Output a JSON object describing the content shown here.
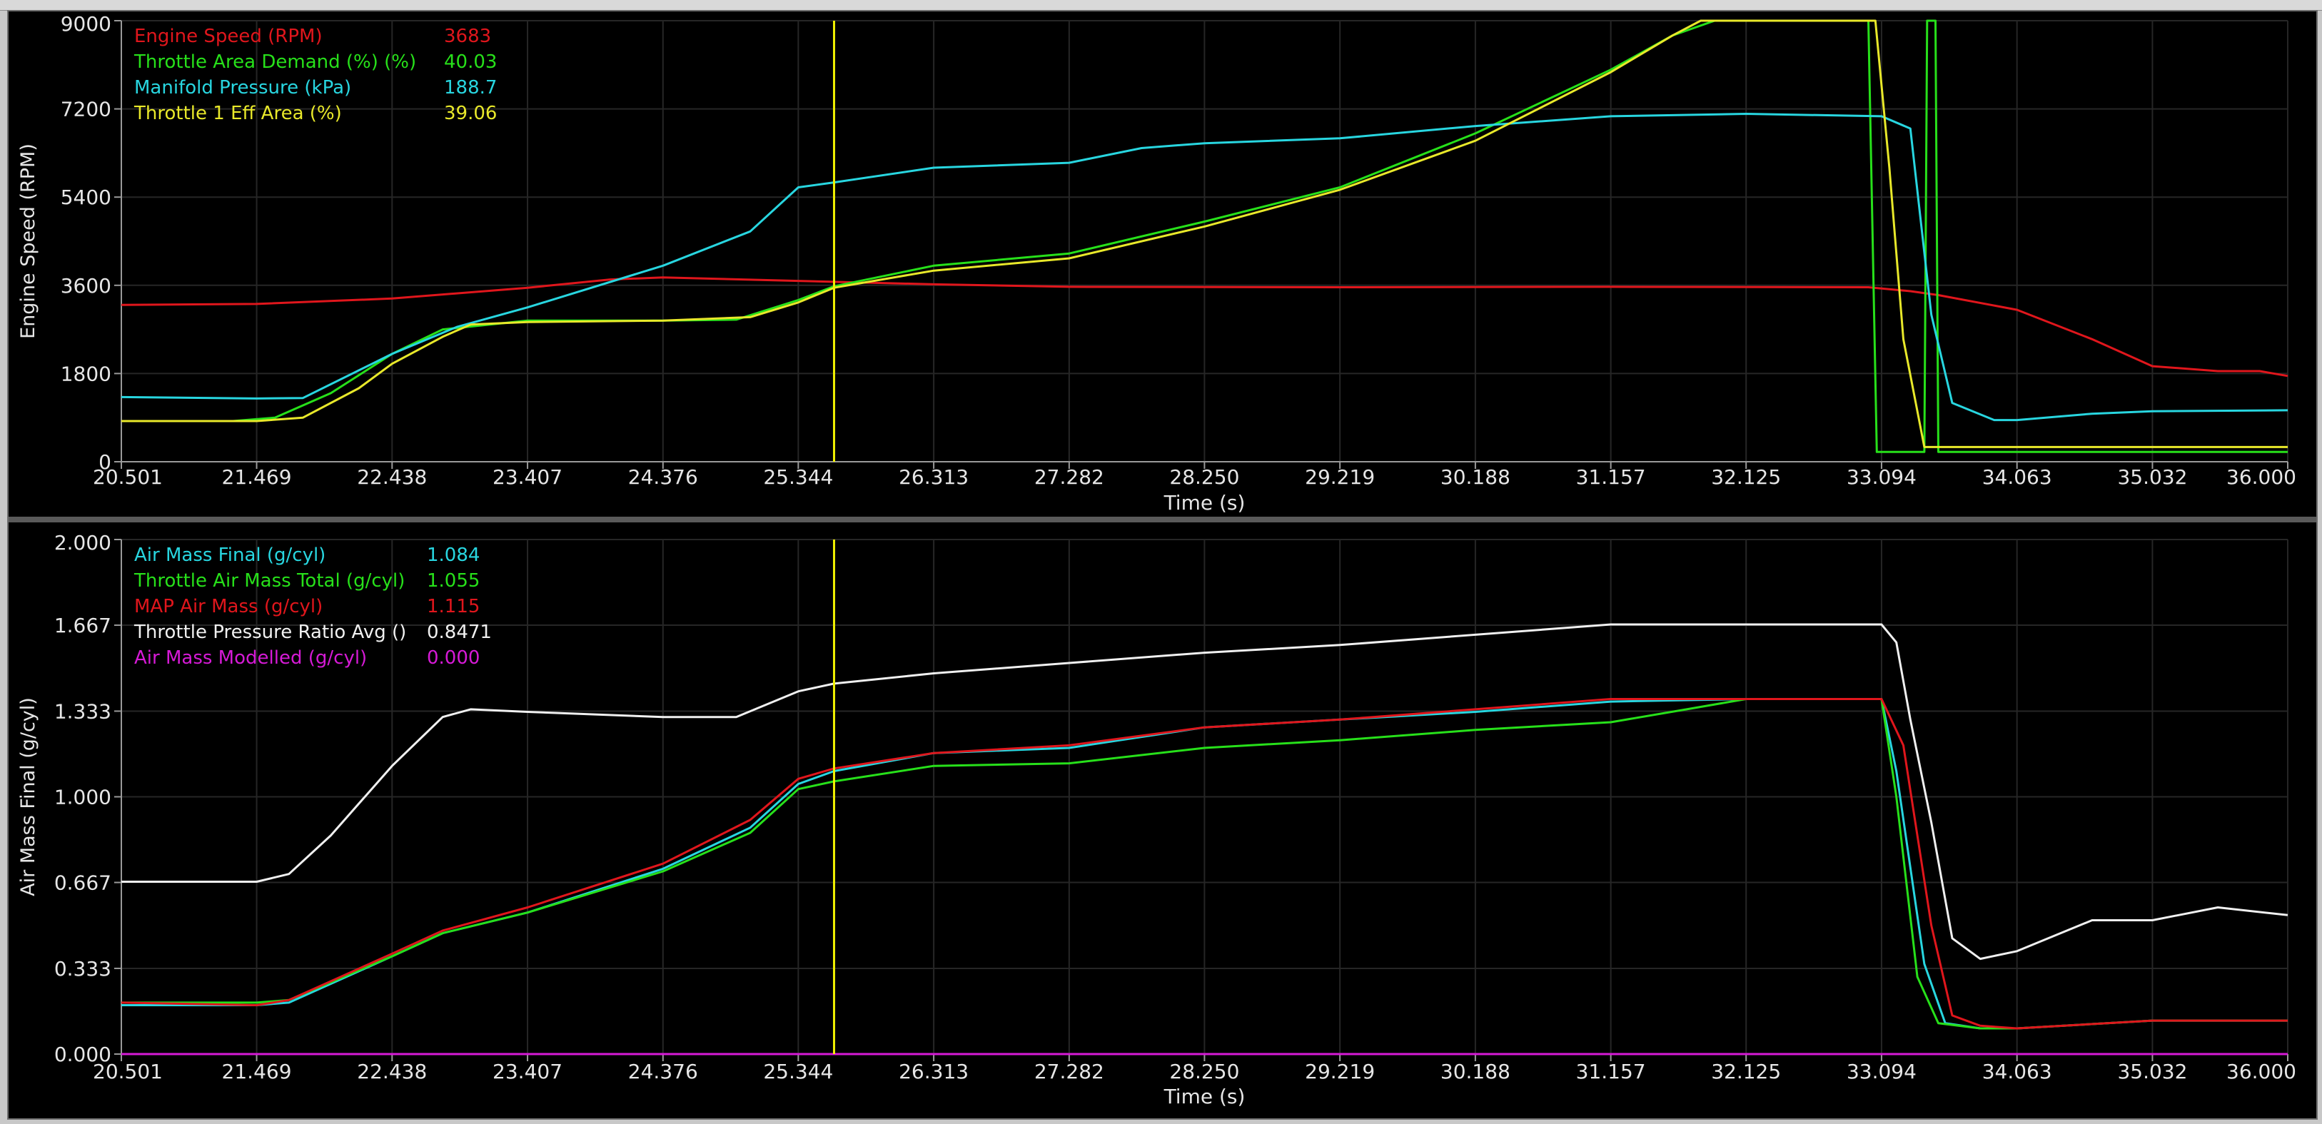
{
  "top": {
    "ylabel": "Engine Speed (RPM)",
    "xlabel": "Time (s)",
    "legend": [
      {
        "label": "Engine Speed (RPM)",
        "value": "3683",
        "color": "#e0161c"
      },
      {
        "label": "Throttle Area Demand  (%) (%)",
        "value": "40.03",
        "color": "#27e01a"
      },
      {
        "label": "Manifold Pressure (kPa)",
        "value": "188.7",
        "color": "#28d6e0"
      },
      {
        "label": "Throttle 1 Eff Area (%)",
        "value": "39.06",
        "color": "#e8e82a"
      }
    ]
  },
  "bottom": {
    "ylabel": "Air Mass Final (g/cyl)",
    "xlabel": "Time (s)",
    "legend": [
      {
        "label": "Air Mass Final (g/cyl)",
        "value": "1.084",
        "color": "#28d6e0"
      },
      {
        "label": "Throttle Air Mass Total (g/cyl)",
        "value": "1.055",
        "color": "#27e01a"
      },
      {
        "label": "MAP Air Mass (g/cyl)",
        "value": "1.115",
        "color": "#e0161c"
      },
      {
        "label": "Throttle Pressure Ratio Avg ()",
        "value": "0.8471",
        "color": "#f0f0f0"
      },
      {
        "label": "Air Mass Modelled  (g/cyl)",
        "value": "0.000",
        "color": "#d61ad6"
      }
    ]
  },
  "chart_data": [
    {
      "type": "line",
      "ylabel": "Engine Speed (RPM)",
      "xlabel": "Time (s)",
      "xlim": [
        20.501,
        36.0
      ],
      "ylim": [
        0,
        9000
      ],
      "xticks": [
        "20.501",
        "21.469",
        "22.438",
        "23.407",
        "24.376",
        "25.344",
        "26.313",
        "27.282",
        "28.250",
        "29.219",
        "30.188",
        "31.157",
        "32.125",
        "33.094",
        "34.063",
        "35.032",
        "36.000"
      ],
      "yticks": [
        "0",
        "1800",
        "3600",
        "5400",
        "7200",
        "9000"
      ],
      "cursor_x": 25.6,
      "series": [
        {
          "name": "Engine Speed (RPM)",
          "color": "#e0161c",
          "points": [
            [
              20.501,
              3200
            ],
            [
              21.469,
              3220
            ],
            [
              22.438,
              3330
            ],
            [
              23.407,
              3550
            ],
            [
              24.0,
              3720
            ],
            [
              24.376,
              3760
            ],
            [
              25.344,
              3690
            ],
            [
              26.313,
              3620
            ],
            [
              27.282,
              3570
            ],
            [
              29.219,
              3560
            ],
            [
              31.157,
              3570
            ],
            [
              33.0,
              3560
            ],
            [
              33.3,
              3480
            ],
            [
              33.5,
              3400
            ],
            [
              34.063,
              3100
            ],
            [
              34.6,
              2500
            ],
            [
              35.032,
              1950
            ],
            [
              35.5,
              1850
            ],
            [
              35.8,
              1850
            ],
            [
              36.0,
              1750
            ]
          ]
        },
        {
          "name": "Throttle Area Demand  (%) (%)",
          "color": "#27e01a",
          "points": [
            [
              20.501,
              830
            ],
            [
              21.3,
              830
            ],
            [
              21.6,
              900
            ],
            [
              22.0,
              1400
            ],
            [
              22.438,
              2200
            ],
            [
              22.8,
              2700
            ],
            [
              23.407,
              2880
            ],
            [
              24.376,
              2880
            ],
            [
              24.9,
              2900
            ],
            [
              25.344,
              3300
            ],
            [
              25.6,
              3580
            ],
            [
              26.313,
              4000
            ],
            [
              27.282,
              4250
            ],
            [
              28.25,
              4900
            ],
            [
              29.219,
              5600
            ],
            [
              30.188,
              6700
            ],
            [
              31.157,
              8000
            ],
            [
              31.6,
              8700
            ],
            [
              31.9,
              9000
            ],
            [
              33.0,
              9000
            ],
            [
              33.06,
              200
            ],
            [
              33.4,
              200
            ],
            [
              33.42,
              9000
            ],
            [
              33.48,
              9000
            ],
            [
              33.5,
              200
            ],
            [
              34.063,
              200
            ],
            [
              36.0,
              200
            ]
          ]
        },
        {
          "name": "Manifold Pressure (kPa)",
          "color": "#28d6e0",
          "points": [
            [
              20.501,
              1320
            ],
            [
              21.469,
              1290
            ],
            [
              21.8,
              1300
            ],
            [
              22.438,
              2200
            ],
            [
              22.9,
              2750
            ],
            [
              23.407,
              3150
            ],
            [
              24.376,
              4000
            ],
            [
              25.0,
              4700
            ],
            [
              25.344,
              5600
            ],
            [
              25.6,
              5700
            ],
            [
              26.313,
              6000
            ],
            [
              27.282,
              6100
            ],
            [
              27.8,
              6400
            ],
            [
              28.25,
              6500
            ],
            [
              29.219,
              6600
            ],
            [
              30.188,
              6850
            ],
            [
              31.157,
              7050
            ],
            [
              32.125,
              7100
            ],
            [
              33.094,
              7050
            ],
            [
              33.3,
              6800
            ],
            [
              33.45,
              3000
            ],
            [
              33.6,
              1200
            ],
            [
              33.9,
              850
            ],
            [
              34.063,
              850
            ],
            [
              34.6,
              980
            ],
            [
              35.032,
              1030
            ],
            [
              36.0,
              1050
            ]
          ]
        },
        {
          "name": "Throttle 1 Eff Area (%)",
          "color": "#e8e82a",
          "points": [
            [
              20.501,
              830
            ],
            [
              21.469,
              830
            ],
            [
              21.8,
              900
            ],
            [
              22.2,
              1500
            ],
            [
              22.438,
              2000
            ],
            [
              22.8,
              2550
            ],
            [
              23.0,
              2800
            ],
            [
              23.407,
              2850
            ],
            [
              24.376,
              2880
            ],
            [
              25.0,
              2950
            ],
            [
              25.344,
              3250
            ],
            [
              25.6,
              3550
            ],
            [
              26.313,
              3900
            ],
            [
              27.282,
              4150
            ],
            [
              28.25,
              4800
            ],
            [
              29.219,
              5550
            ],
            [
              30.188,
              6550
            ],
            [
              31.157,
              7950
            ],
            [
              31.6,
              8700
            ],
            [
              31.8,
              9000
            ],
            [
              33.05,
              9000
            ],
            [
              33.15,
              6000
            ],
            [
              33.25,
              2500
            ],
            [
              33.4,
              300
            ],
            [
              33.6,
              300
            ],
            [
              34.063,
              300
            ],
            [
              36.0,
              300
            ]
          ]
        }
      ]
    },
    {
      "type": "line",
      "ylabel": "Air Mass Final (g/cyl)",
      "xlabel": "Time (s)",
      "xlim": [
        20.501,
        36.0
      ],
      "ylim": [
        0,
        2.0
      ],
      "xticks": [
        "20.501",
        "21.469",
        "22.438",
        "23.407",
        "24.376",
        "25.344",
        "26.313",
        "27.282",
        "28.250",
        "29.219",
        "30.188",
        "31.157",
        "32.125",
        "33.094",
        "34.063",
        "35.032",
        "36.000"
      ],
      "yticks": [
        "0.000",
        "0.333",
        "0.667",
        "1.000",
        "1.333",
        "1.667",
        "2.000"
      ],
      "cursor_x": 25.6,
      "series": [
        {
          "name": "Air Mass Final (g/cyl)",
          "color": "#28d6e0",
          "points": [
            [
              20.501,
              0.19
            ],
            [
              21.469,
              0.19
            ],
            [
              21.7,
              0.2
            ],
            [
              22.438,
              0.38
            ],
            [
              22.8,
              0.47
            ],
            [
              23.407,
              0.55
            ],
            [
              24.376,
              0.72
            ],
            [
              25.0,
              0.88
            ],
            [
              25.344,
              1.05
            ],
            [
              25.6,
              1.1
            ],
            [
              26.313,
              1.17
            ],
            [
              27.282,
              1.19
            ],
            [
              28.25,
              1.27
            ],
            [
              29.219,
              1.3
            ],
            [
              30.188,
              1.33
            ],
            [
              31.157,
              1.37
            ],
            [
              32.125,
              1.38
            ],
            [
              33.094,
              1.38
            ],
            [
              33.2,
              1.1
            ],
            [
              33.4,
              0.35
            ],
            [
              33.55,
              0.12
            ],
            [
              33.8,
              0.1
            ],
            [
              34.063,
              0.1
            ],
            [
              35.032,
              0.13
            ],
            [
              36.0,
              0.13
            ]
          ]
        },
        {
          "name": "Throttle Air Mass Total (g/cyl)",
          "color": "#27e01a",
          "points": [
            [
              20.501,
              0.2
            ],
            [
              21.469,
              0.2
            ],
            [
              21.7,
              0.21
            ],
            [
              22.438,
              0.38
            ],
            [
              22.8,
              0.47
            ],
            [
              23.407,
              0.55
            ],
            [
              24.376,
              0.71
            ],
            [
              25.0,
              0.86
            ],
            [
              25.344,
              1.03
            ],
            [
              25.6,
              1.06
            ],
            [
              26.313,
              1.12
            ],
            [
              27.282,
              1.13
            ],
            [
              28.25,
              1.19
            ],
            [
              29.219,
              1.22
            ],
            [
              30.188,
              1.26
            ],
            [
              31.157,
              1.29
            ],
            [
              31.7,
              1.34
            ],
            [
              32.125,
              1.38
            ],
            [
              33.094,
              1.38
            ],
            [
              33.2,
              1.0
            ],
            [
              33.35,
              0.3
            ],
            [
              33.5,
              0.12
            ],
            [
              33.8,
              0.1
            ],
            [
              34.063,
              0.1
            ],
            [
              35.032,
              0.13
            ],
            [
              36.0,
              0.13
            ]
          ]
        },
        {
          "name": "MAP Air Mass (g/cyl)",
          "color": "#e0161c",
          "points": [
            [
              20.501,
              0.2
            ],
            [
              21.469,
              0.19
            ],
            [
              21.7,
              0.21
            ],
            [
              22.438,
              0.39
            ],
            [
              22.8,
              0.48
            ],
            [
              23.407,
              0.57
            ],
            [
              24.376,
              0.74
            ],
            [
              25.0,
              0.91
            ],
            [
              25.344,
              1.07
            ],
            [
              25.6,
              1.11
            ],
            [
              26.313,
              1.17
            ],
            [
              27.282,
              1.2
            ],
            [
              28.25,
              1.27
            ],
            [
              29.219,
              1.3
            ],
            [
              30.188,
              1.34
            ],
            [
              31.157,
              1.38
            ],
            [
              32.125,
              1.38
            ],
            [
              33.094,
              1.38
            ],
            [
              33.25,
              1.2
            ],
            [
              33.45,
              0.5
            ],
            [
              33.6,
              0.15
            ],
            [
              33.8,
              0.11
            ],
            [
              34.063,
              0.1
            ],
            [
              35.032,
              0.13
            ],
            [
              36.0,
              0.13
            ]
          ]
        },
        {
          "name": "Throttle Pressure Ratio Avg ()",
          "color": "#f0f0f0",
          "points": [
            [
              20.501,
              0.67
            ],
            [
              21.469,
              0.67
            ],
            [
              21.7,
              0.7
            ],
            [
              22.0,
              0.85
            ],
            [
              22.438,
              1.12
            ],
            [
              22.8,
              1.31
            ],
            [
              23.0,
              1.34
            ],
            [
              23.407,
              1.33
            ],
            [
              24.376,
              1.31
            ],
            [
              24.9,
              1.31
            ],
            [
              25.344,
              1.41
            ],
            [
              25.6,
              1.44
            ],
            [
              26.313,
              1.48
            ],
            [
              27.282,
              1.52
            ],
            [
              28.25,
              1.56
            ],
            [
              29.219,
              1.59
            ],
            [
              30.188,
              1.63
            ],
            [
              31.157,
              1.67
            ],
            [
              32.125,
              1.67
            ],
            [
              33.094,
              1.67
            ],
            [
              33.2,
              1.6
            ],
            [
              33.3,
              1.3
            ],
            [
              33.45,
              0.9
            ],
            [
              33.6,
              0.45
            ],
            [
              33.8,
              0.37
            ],
            [
              34.063,
              0.4
            ],
            [
              34.6,
              0.52
            ],
            [
              35.032,
              0.52
            ],
            [
              35.5,
              0.57
            ],
            [
              36.0,
              0.54
            ]
          ]
        },
        {
          "name": "Air Mass Modelled  (g/cyl)",
          "color": "#d61ad6",
          "points": [
            [
              20.501,
              0.0
            ],
            [
              36.0,
              0.0
            ]
          ]
        }
      ]
    }
  ]
}
